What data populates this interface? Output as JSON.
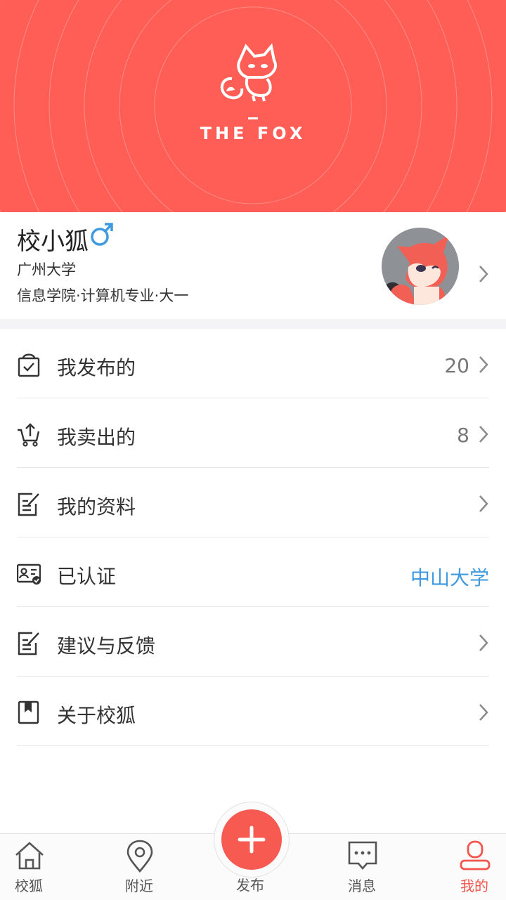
{
  "banner": {
    "logo_text": "THE FOX"
  },
  "profile": {
    "name": "校小狐",
    "gender_symbol": "♂",
    "school": "广州大学",
    "department": "信息学院·计算机专业·大一"
  },
  "menu": {
    "items": [
      {
        "label": "我发布的",
        "value": "20",
        "icon": "bag-check-icon"
      },
      {
        "label": "我卖出的",
        "value": "8",
        "icon": "cart-upload-icon"
      },
      {
        "label": "我的资料",
        "value": "",
        "icon": "edit-doc-icon"
      },
      {
        "label": "已认证",
        "value": "中山大学",
        "icon": "id-card-verified-icon"
      },
      {
        "label": "建议与反馈",
        "value": "",
        "icon": "feedback-icon"
      },
      {
        "label": "关于校狐",
        "value": "",
        "icon": "bookmark-icon"
      }
    ]
  },
  "tabbar": {
    "tabs": [
      {
        "label": "校狐",
        "icon": "home-icon"
      },
      {
        "label": "附近",
        "icon": "location-icon"
      },
      {
        "label": "发布",
        "icon": "plus-icon"
      },
      {
        "label": "消息",
        "icon": "message-icon"
      },
      {
        "label": "我的",
        "icon": "person-icon"
      }
    ],
    "active": "我的"
  },
  "colors": {
    "brand": "#fe5e55",
    "link": "#3f9ae0",
    "active_tab": "#f2554c"
  }
}
